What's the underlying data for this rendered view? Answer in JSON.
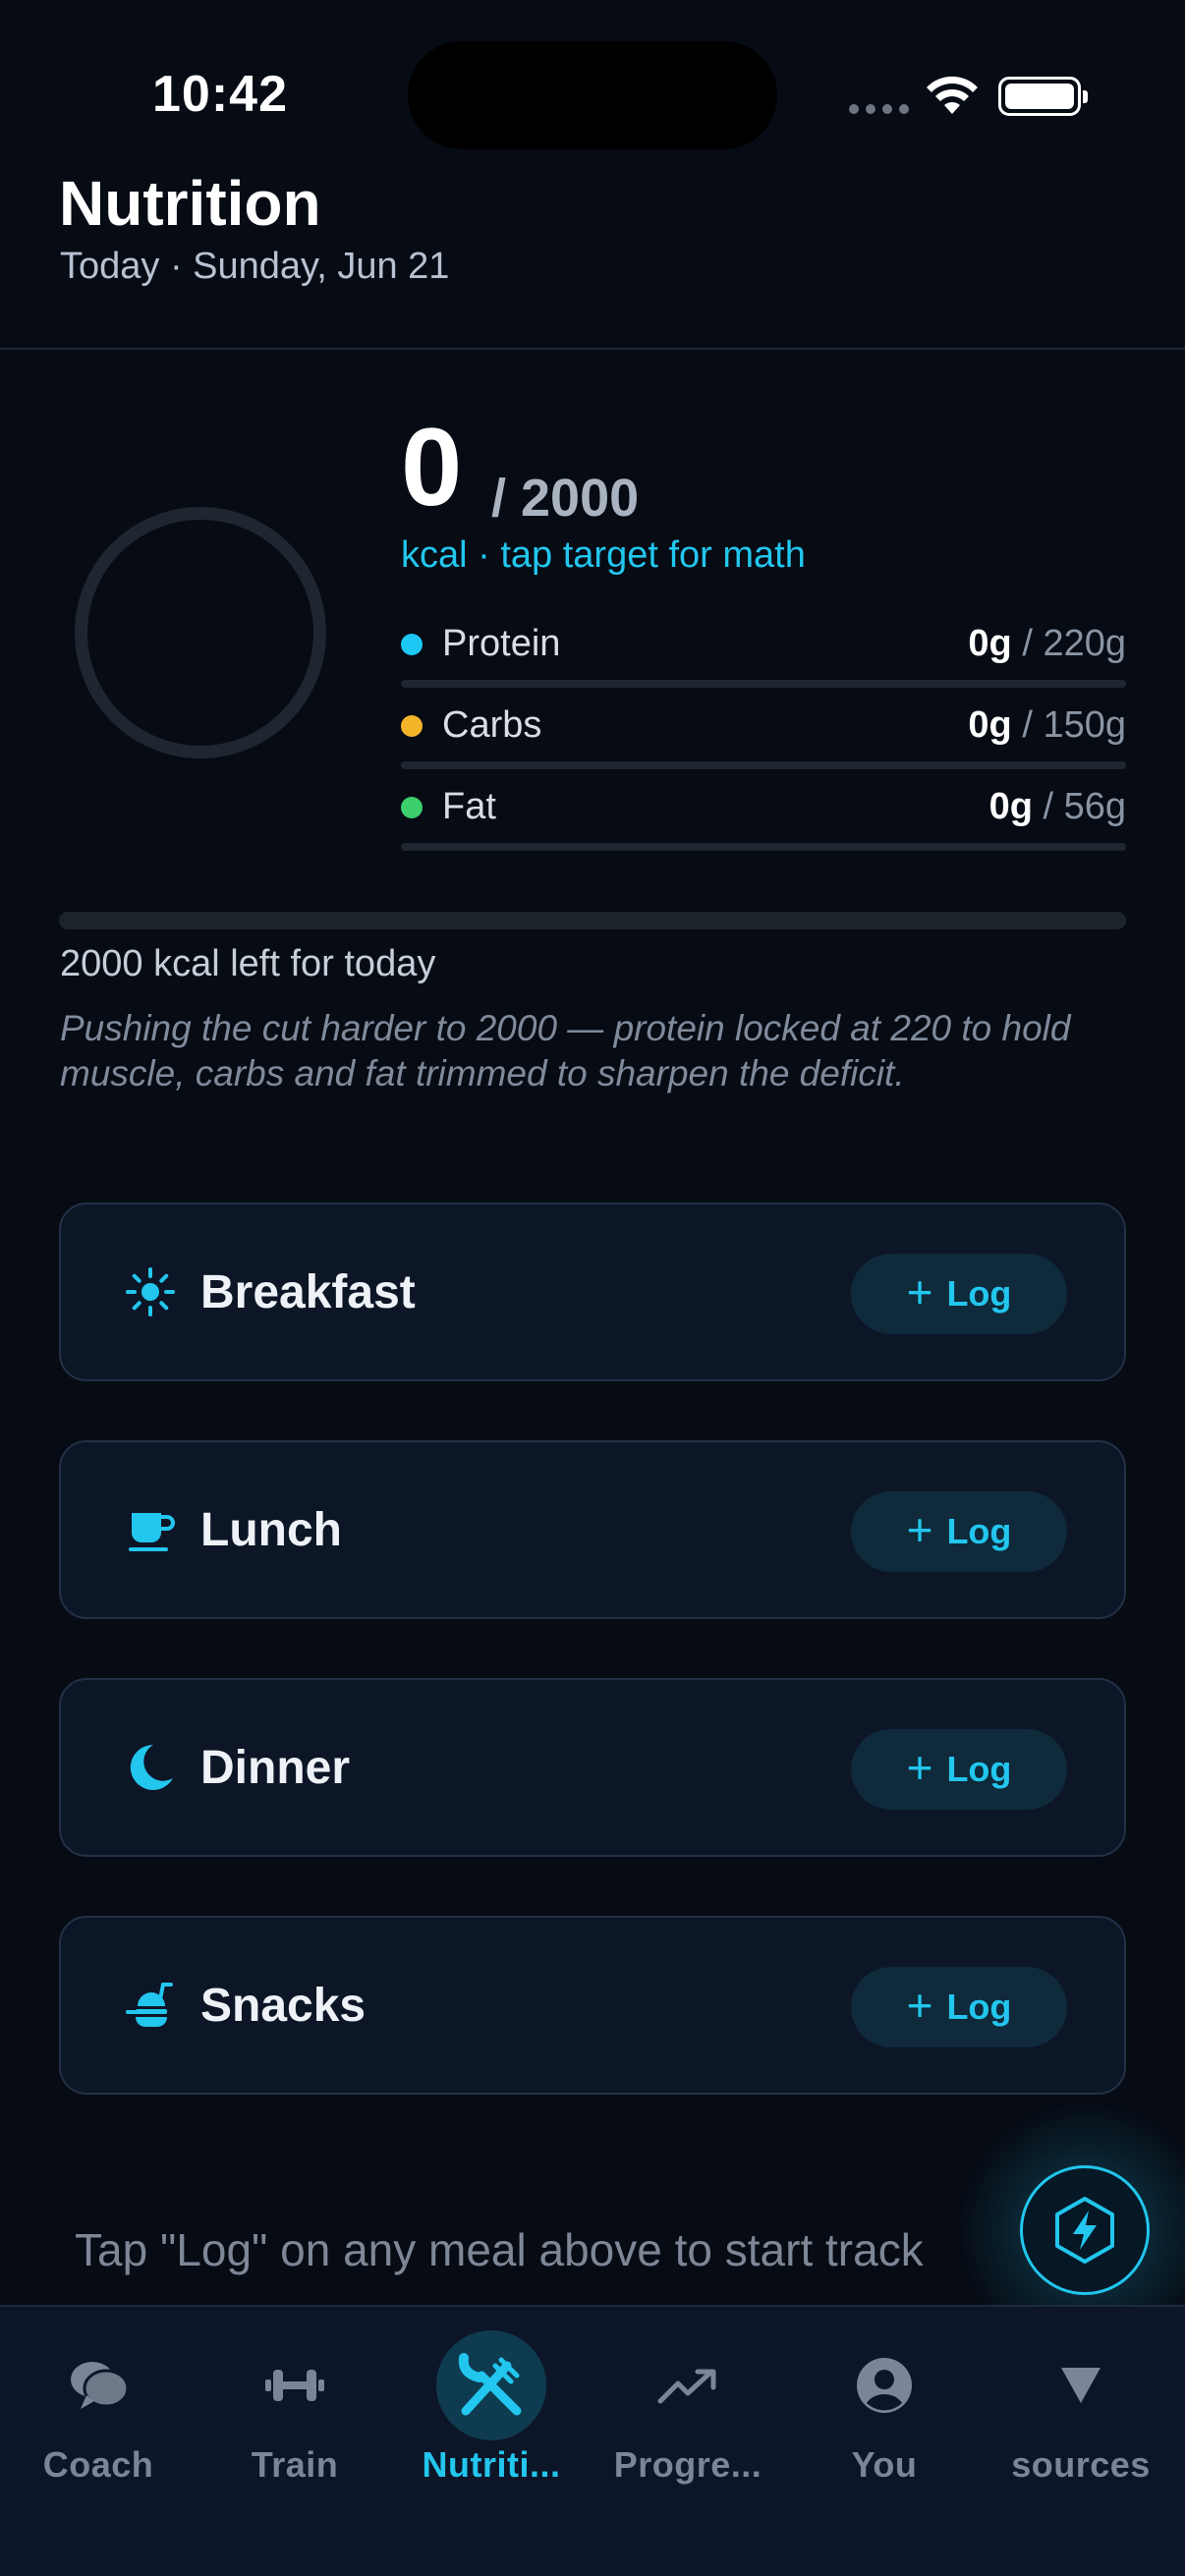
{
  "status_bar": {
    "time": "10:42"
  },
  "header": {
    "title": "Nutrition",
    "subtitle": "Today · Sunday, Jun 21"
  },
  "summary": {
    "kcal_consumed": "0",
    "kcal_target": "/ 2000",
    "hint": "kcal · tap target for math",
    "ring_progress": 0,
    "macros": [
      {
        "label": "Protein",
        "current": "0g",
        "goal": " / 220g",
        "color": "#1ec8f5",
        "progress": 0
      },
      {
        "label": "Carbs",
        "current": "0g",
        "goal": " / 150g",
        "color": "#f5b52a",
        "progress": 0
      },
      {
        "label": "Fat",
        "current": "0g",
        "goal": " / 56g",
        "color": "#3ccf6b",
        "progress": 0
      }
    ],
    "day_progress": 0,
    "kcal_left": "2000 kcal left for today",
    "coach_note": "Pushing the cut harder to 2000 — protein locked at 220 to hold muscle, carbs and fat trimmed to sharpen the deficit."
  },
  "meals": [
    {
      "name": "Breakfast",
      "icon": "sun-icon",
      "log_label": "Log"
    },
    {
      "name": "Lunch",
      "icon": "coffee-cup-icon",
      "log_label": "Log"
    },
    {
      "name": "Dinner",
      "icon": "moon-icon",
      "log_label": "Log"
    },
    {
      "name": "Snacks",
      "icon": "snack-icon",
      "log_label": "Log"
    }
  ],
  "empty_hint": "Tap \"Log\" on any meal above to start track",
  "fab": {
    "icon": "bolt-hexagon-icon"
  },
  "tabs": [
    {
      "label": "Coach",
      "icon": "chat-bubbles-icon",
      "active": false
    },
    {
      "label": "Train",
      "icon": "dumbbell-icon",
      "active": false
    },
    {
      "label": "Nutriti...",
      "icon": "fork-knife-icon",
      "active": true
    },
    {
      "label": "Progre...",
      "icon": "trend-up-icon",
      "active": false
    },
    {
      "label": "You",
      "icon": "person-circle-icon",
      "active": false
    },
    {
      "label": "sources",
      "icon": "triangle-down-icon",
      "active": false
    }
  ],
  "colors": {
    "accent": "#22c6ee",
    "background": "#060b14",
    "card": "#0c1627"
  }
}
